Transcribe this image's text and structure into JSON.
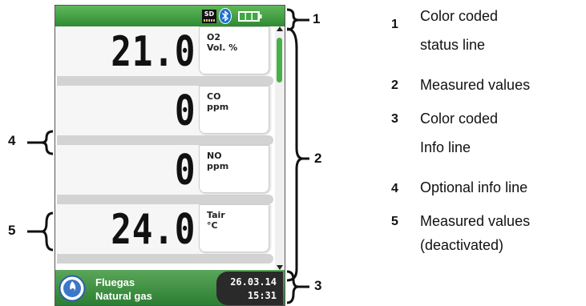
{
  "screen": {
    "status_bar": {
      "sd_label": "SD",
      "bluetooth_icon": "bluetooth-icon",
      "battery_icon": "battery-icon",
      "color": "#3f9b3f"
    },
    "rows": [
      {
        "value": "21.0",
        "param": "O2",
        "unit": "Vol. %"
      },
      {
        "value": "0",
        "param": "CO",
        "unit": "ppm"
      },
      {
        "value": "0",
        "param": "NO",
        "unit": "ppm"
      },
      {
        "value": "24.0",
        "param": "Tair",
        "unit": "°C"
      }
    ],
    "info_bar": {
      "fuel_type": "Fluegas",
      "fuel_name": "Natural gas",
      "date": "26.03.14",
      "time": "15:31",
      "color": "#3a8f3a"
    }
  },
  "callouts": [
    "1",
    "2",
    "3",
    "4",
    "5"
  ],
  "legend": [
    {
      "num": "1",
      "lines": [
        "Color coded",
        "status line"
      ]
    },
    {
      "num": "2",
      "lines": [
        "Measured values"
      ]
    },
    {
      "num": "3",
      "lines": [
        "Color coded",
        "Info line"
      ]
    },
    {
      "num": "4",
      "lines": [
        "Optional info line"
      ]
    },
    {
      "num": "5",
      "lines": [
        "Measured values",
        "(deactivated)"
      ]
    }
  ]
}
